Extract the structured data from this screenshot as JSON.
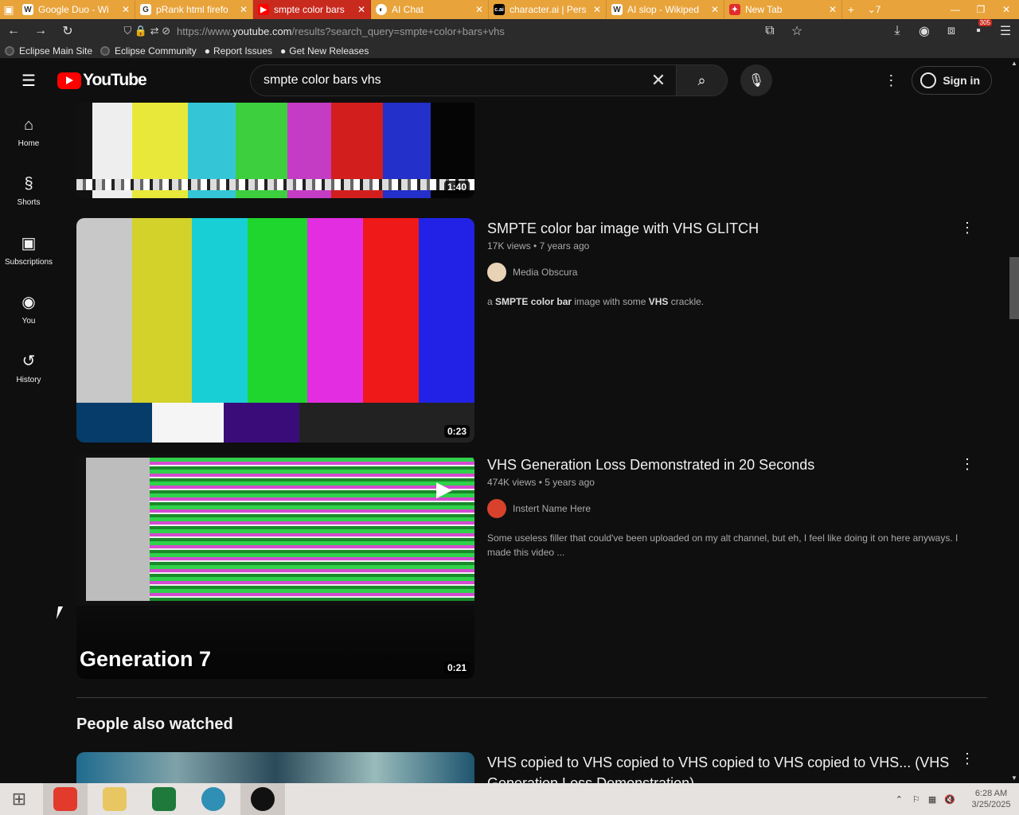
{
  "browser": {
    "tabs": [
      {
        "icon": "W",
        "title": "Google Duo - Wi",
        "active": false
      },
      {
        "icon": "G",
        "title": "pRank html firefo",
        "active": false
      },
      {
        "icon": "yt",
        "title": "smpte color bars",
        "active": true
      },
      {
        "icon": "ai",
        "title": "AI Chat",
        "active": false
      },
      {
        "icon": "c.ai",
        "title": "character.ai | Pers",
        "active": false
      },
      {
        "icon": "W",
        "title": "AI slop - Wikiped",
        "active": false
      },
      {
        "icon": "fx",
        "title": "New Tab",
        "active": false
      }
    ],
    "tab_overflow_count": "7",
    "url_prefix": "https://www.",
    "url_host": "youtube.com",
    "url_path": "/results?search_query=smpte+color+bars+vhs",
    "notification_count": "305",
    "bookmarks": [
      "Eclipse Main Site",
      "Eclipse Community",
      "Report Issues",
      "Get New Releases"
    ]
  },
  "youtube": {
    "logo_text": "YouTube",
    "search_query": "smpte color bars vhs",
    "signin_label": "Sign in",
    "sidebar": [
      {
        "label": "Home",
        "icon": "home-icon",
        "glyph": "⌂"
      },
      {
        "label": "Shorts",
        "icon": "shorts-icon",
        "glyph": "§"
      },
      {
        "label": "Subscriptions",
        "icon": "subscriptions-icon",
        "glyph": "▣"
      },
      {
        "label": "You",
        "icon": "you-icon",
        "glyph": "◉"
      },
      {
        "label": "History",
        "icon": "history-icon",
        "glyph": "↺"
      }
    ],
    "results": [
      {
        "title": "",
        "duration": "1:40"
      },
      {
        "title": "SMPTE color bar image with VHS GLITCH",
        "views": "17K views",
        "age": "7 years ago",
        "channel": "Media Obscura",
        "description_parts": [
          "a ",
          "SMPTE color bar",
          " image with some ",
          "VHS",
          " crackle."
        ],
        "duration": "0:23"
      },
      {
        "title": "VHS Generation Loss Demonstrated in 20 Seconds",
        "views": "474K views",
        "age": "5 years ago",
        "channel": "Instert Name Here",
        "description": "Some useless filler that could've been uploaded on my alt channel, but eh, I feel like doing it on here anyways. I made this video ...",
        "duration": "0:21",
        "thumb_caption": "Generation 7"
      }
    ],
    "section_heading": "People also watched",
    "next_result_title": "VHS copied to VHS copied to VHS copied to VHS copied to VHS... (VHS Generation Loss Demonstration)"
  },
  "taskbar": {
    "time": "6:28 AM",
    "date": "3/25/2025"
  },
  "colors": {
    "tab_bar": "#e8a33a",
    "active_tab": "#c92a1e",
    "yt_red": "#ff0000",
    "bg": "#0f0f0f"
  }
}
